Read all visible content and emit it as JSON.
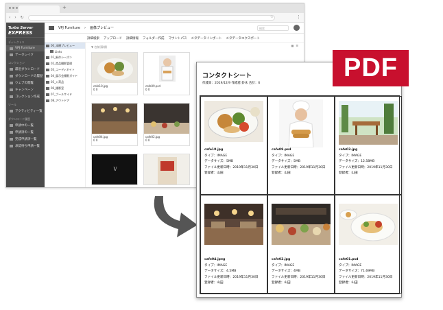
{
  "browser": {
    "tab_label": "",
    "new_tab": "+"
  },
  "app": {
    "logo_line1": "Turbo Server",
    "logo_line2": "EXPRESS",
    "side_sections": [
      {
        "title": "ディレクトリ",
        "items": [
          "VPJ Furniture",
          "データレイク"
        ]
      },
      {
        "title": "コレクション",
        "items": [
          "最近ダウンロード",
          "ダウンロードの履歴",
          "ウェブの閲覧",
          "キャンペーン",
          "コレクション作成"
        ]
      },
      {
        "title": "ツール",
        "items": [
          "アクティビティ一覧"
        ]
      },
      {
        "title": "ダウンロード履歴",
        "items": [
          "申請中の一覧",
          "申請済の一覧",
          "完成申請済一覧",
          "承認待ち申請一覧"
        ]
      }
    ],
    "breadcrumb": [
      "VPJ Furniture",
      "画像プレビュー"
    ],
    "search_placeholder": "検索",
    "toolbar": [
      "詳細検索",
      "アップロード",
      "詳細情報",
      "フォルダー作成",
      "マウントパス",
      "メタデータインポート",
      "メタデータエクスポート"
    ],
    "tree": [
      "00_本棚プレビュー",
      "Links",
      "01_新作シーズン",
      "02_商品撮影管理",
      "03_コーディネイト",
      "04_展示会撮影ガイド",
      "05_入荷品",
      "06_撮影室",
      "07_プールサイド",
      "08_アウトドア"
    ],
    "sort_label": "▼ 名前(昇順)",
    "cards": [
      {
        "name": "cafe10.jpg",
        "stats": "0  0"
      },
      {
        "name": "cafe09.psd",
        "stats": "0  0"
      },
      {
        "name": "cafe04.jpg",
        "stats": "0  0"
      },
      {
        "name": "cafe02.jpg",
        "stats": "0  0"
      }
    ]
  },
  "sheet": {
    "title": "コンタクトシート",
    "subtitle": "作成日：2019/12/9 作成者 鈴木 合計：6",
    "items": [
      {
        "file": "cafe10.jpg",
        "type": "タイプ：IMAGE",
        "size": "データサイズ：5MB",
        "updated": "ファイル更新日時：2019年11月30日",
        "owner": "登録者：山田"
      },
      {
        "file": "cafe09.psd",
        "type": "タイプ：IMAGE",
        "size": "データサイズ：5MB",
        "updated": "ファイル更新日時：2019年11月30日",
        "owner": "登録者：山田"
      },
      {
        "file": "cafe03.jpg",
        "type": "タイプ：IMAGE",
        "size": "データサイズ：12.58MB",
        "updated": "ファイル更新日時：2019年11月30日",
        "owner": "登録者：山田"
      },
      {
        "file": "cafe04.jpeg",
        "type": "タイプ：IMAGE",
        "size": "データサイズ：4.5MB",
        "updated": "ファイル更新日時：2019年11月30日",
        "owner": "登録者：山田"
      },
      {
        "file": "cafe02.jpg",
        "type": "タイプ：IMAGE",
        "size": "データサイズ：4MB",
        "updated": "ファイル更新日時：2019年11月30日",
        "owner": "登録者：山田"
      },
      {
        "file": "cafe01.psd",
        "type": "タイプ：IMAGE",
        "size": "データサイズ：71.69MB",
        "updated": "ファイル更新日時：2019年11月30日",
        "owner": "登録者：山田"
      }
    ]
  },
  "badge": {
    "label": "PDF"
  },
  "colors": {
    "badge": "#c8102e",
    "sidebar": "#4a4a4a",
    "arrow": "#555555"
  }
}
